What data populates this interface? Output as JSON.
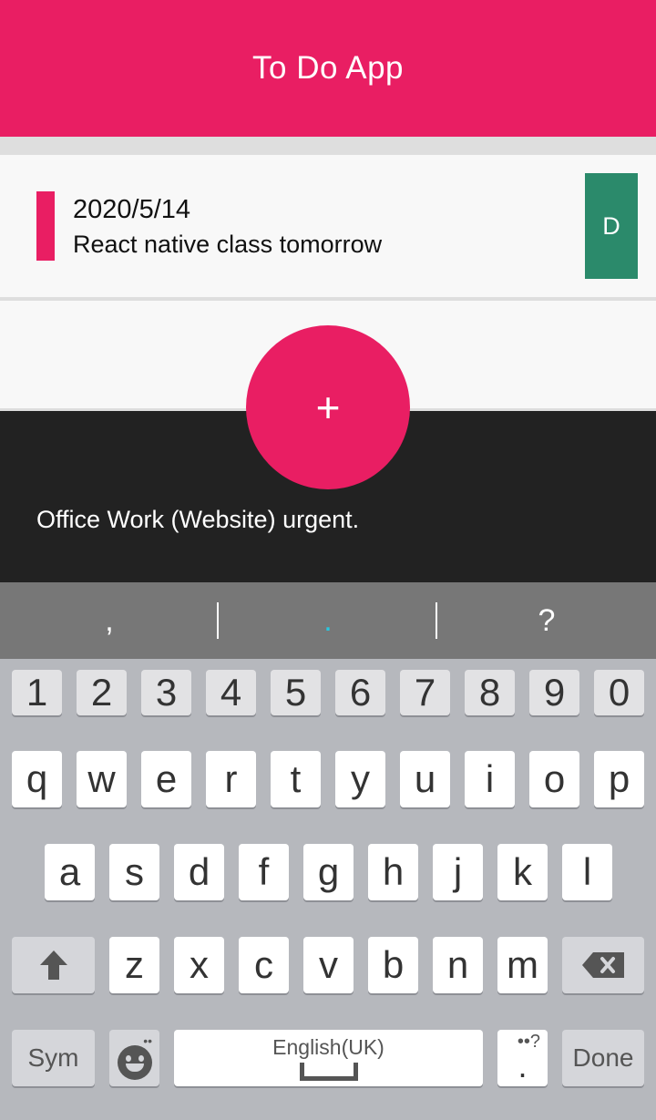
{
  "header": {
    "title": "To Do App"
  },
  "todos": [
    {
      "date": "2020/5/14",
      "text": "React native class tomorrow",
      "delete_label": "D"
    }
  ],
  "fab": {
    "label": "+"
  },
  "input": {
    "value": "Office Work (Website) urgent."
  },
  "keyboard": {
    "suggestions": [
      ",",
      ".",
      "?"
    ],
    "number_row": [
      "1",
      "2",
      "3",
      "4",
      "5",
      "6",
      "7",
      "8",
      "9",
      "0"
    ],
    "row1": [
      "q",
      "w",
      "e",
      "r",
      "t",
      "y",
      "u",
      "i",
      "o",
      "p"
    ],
    "row2": [
      "a",
      "s",
      "d",
      "f",
      "g",
      "h",
      "j",
      "k",
      "l"
    ],
    "row3": [
      "z",
      "x",
      "c",
      "v",
      "b",
      "n",
      "m"
    ],
    "sym_label": "Sym",
    "space_label": "English(UK)",
    "done_label": "Done",
    "period_label": ".",
    "period_hint": "••?",
    "mic_hint": "••",
    "shift_icon": "shift-arrow-icon",
    "backspace_icon": "backspace-icon",
    "emoji_icon": "emoji-icon"
  },
  "colors": {
    "accent": "#e91e63",
    "delete_button": "#2b8a6b",
    "input_panel": "#222222",
    "suggestion_bar": "#777777",
    "keyboard_bg": "#b6b8bd"
  }
}
